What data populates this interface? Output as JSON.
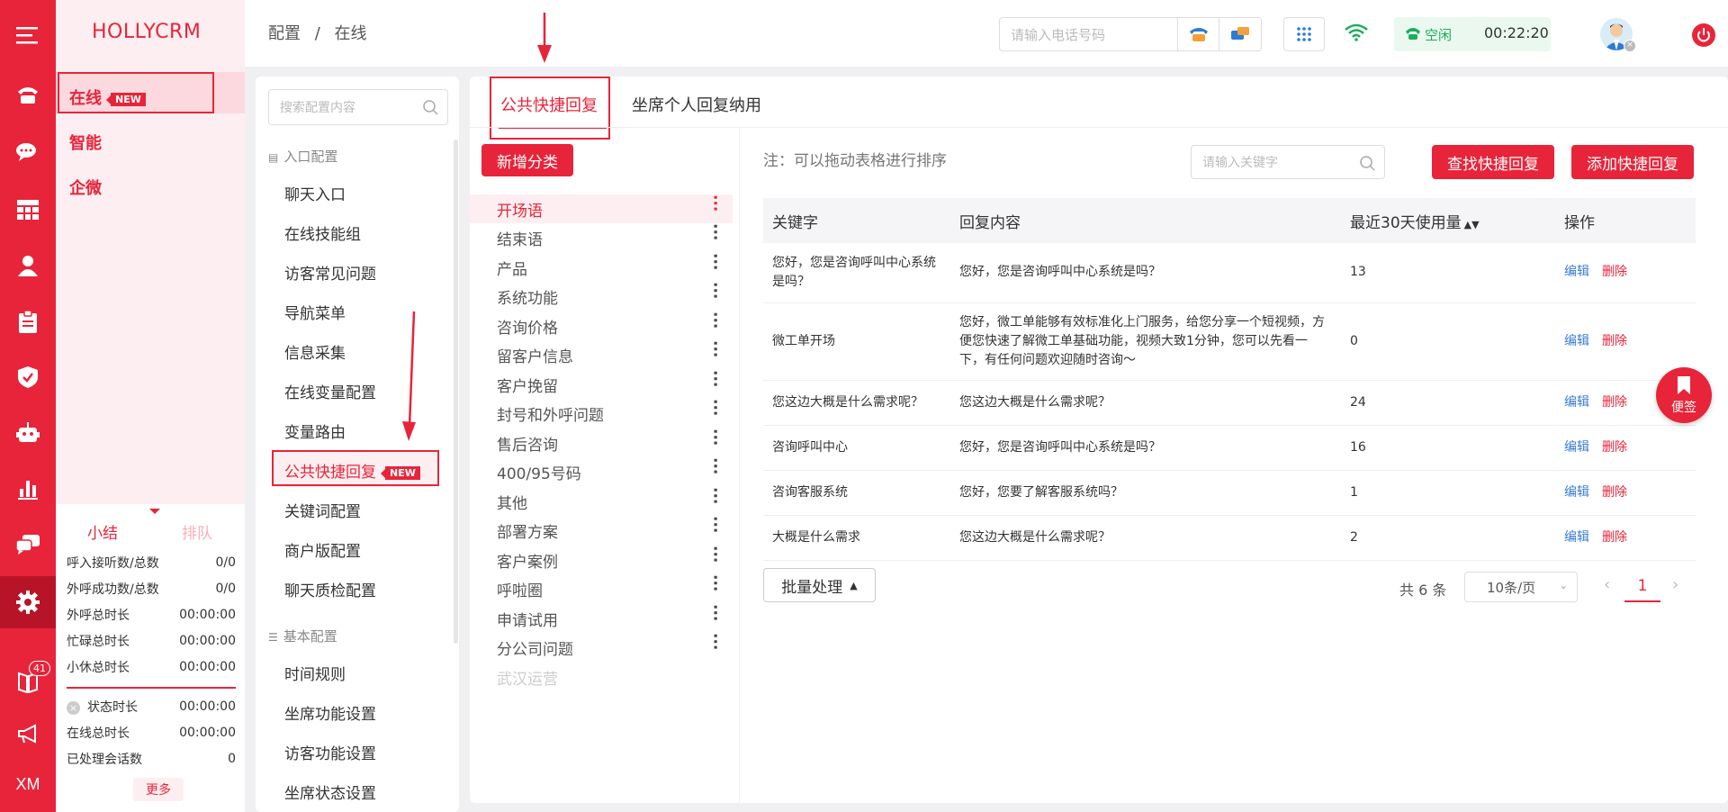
{
  "brand": "HOLLYCRM",
  "sidebar_left": {
    "icons": [
      "menu-icon",
      "phone-icon",
      "chat-icon",
      "grid-icon",
      "user-icon",
      "clipboard-icon",
      "shield-icon",
      "robot-icon",
      "bar-chart-icon",
      "message-icon",
      "gear-icon",
      "book-icon",
      "megaphone-icon"
    ],
    "badge": "41",
    "bottom_label": "XM"
  },
  "topnav": [
    {
      "label": "在线",
      "tag": "NEW"
    },
    {
      "label": "智能"
    },
    {
      "label": "企微"
    }
  ],
  "stats": {
    "tab_summary": "小结",
    "tab_queue": "排队",
    "rows1": [
      {
        "label": "呼入接听数/总数",
        "value": "0/0"
      },
      {
        "label": "外呼成功数/总数",
        "value": "0/0"
      },
      {
        "label": "外呼总时长",
        "value": "00:00:00"
      },
      {
        "label": "忙碌总时长",
        "value": "00:00:00"
      },
      {
        "label": "小休总时长",
        "value": "00:00:00"
      }
    ],
    "rows2": [
      {
        "label": "状态时长",
        "value": "00:00:00"
      },
      {
        "label": "在线总时长",
        "value": "00:00:00"
      },
      {
        "label": "已处理会话数",
        "value": "0"
      }
    ],
    "more": "更多"
  },
  "breadcrumb": {
    "root": "配置",
    "sep": "/",
    "current": "在线"
  },
  "header": {
    "phone_placeholder": "请输入电话号码",
    "status": "空闲",
    "timer": "00:22:20"
  },
  "config": {
    "search_placeholder": "搜索配置内容",
    "group1": "入口配置",
    "items1": [
      "聊天入口",
      "在线技能组",
      "访客常见问题",
      "导航菜单",
      "信息采集",
      "在线变量配置",
      "变量路由",
      "公共快捷回复",
      "关键词配置",
      "商户版配置",
      "聊天质检配置"
    ],
    "active_tag": "NEW",
    "group2": "基本配置",
    "items2": [
      "时间规则",
      "坐席功能设置",
      "访客功能设置",
      "坐席状态设置"
    ]
  },
  "main": {
    "tabs": [
      "公共快捷回复",
      "坐席个人回复纳用"
    ],
    "add_category": "新增分类",
    "categories": [
      "开场语",
      "结束语",
      "产品",
      "系统功能",
      "咨询价格",
      "留客户信息",
      "客户挽留",
      "封号和外呼问题",
      "售后咨询",
      "400/95号码",
      "其他",
      "部署方案",
      "客户案例",
      "呼啦圈",
      "申请试用",
      "分公司问题",
      "武汉运营"
    ],
    "note": "注：可以拖动表格进行排序",
    "keyword_placeholder": "请输入关键字",
    "find_button": "查找快捷回复",
    "add_button": "添加快捷回复",
    "columns": [
      "关键字",
      "回复内容",
      "最近30天使用量",
      "操作"
    ],
    "rows": [
      {
        "keyword": "您好，您是咨询呼叫中心系统是吗？",
        "content": "您好，您是咨询呼叫中心系统是吗？",
        "count": "13"
      },
      {
        "keyword": "微工单开场",
        "content": "您好，微工单能够有效标准化上门服务，给您分享一个短视频，方便您快速了解微工单基础功能，视频大致1分钟，您可以先看一下，有任何问题欢迎随时咨询～",
        "count": "0"
      },
      {
        "keyword": "您这边大概是什么需求呢？",
        "content": "您这边大概是什么需求呢？",
        "count": "24"
      },
      {
        "keyword": "咨询呼叫中心",
        "content": "您好，您是咨询呼叫中心系统是吗？",
        "count": "16"
      },
      {
        "keyword": "咨询客服系统",
        "content": "您好，您要了解客服系统吗？",
        "count": "1"
      },
      {
        "keyword": "大概是什么需求",
        "content": "您这边大概是什么需求呢？",
        "count": "2"
      }
    ],
    "edit_label": "编辑",
    "delete_label": "删除",
    "batch_label": "批量处理",
    "total": "共 6 条",
    "page_size": "10条/页",
    "page": "1"
  },
  "float_note": "便签",
  "colors": {
    "accent": "#e8243a",
    "link": "#3a7bd5",
    "status_green": "#1aaf5d"
  }
}
